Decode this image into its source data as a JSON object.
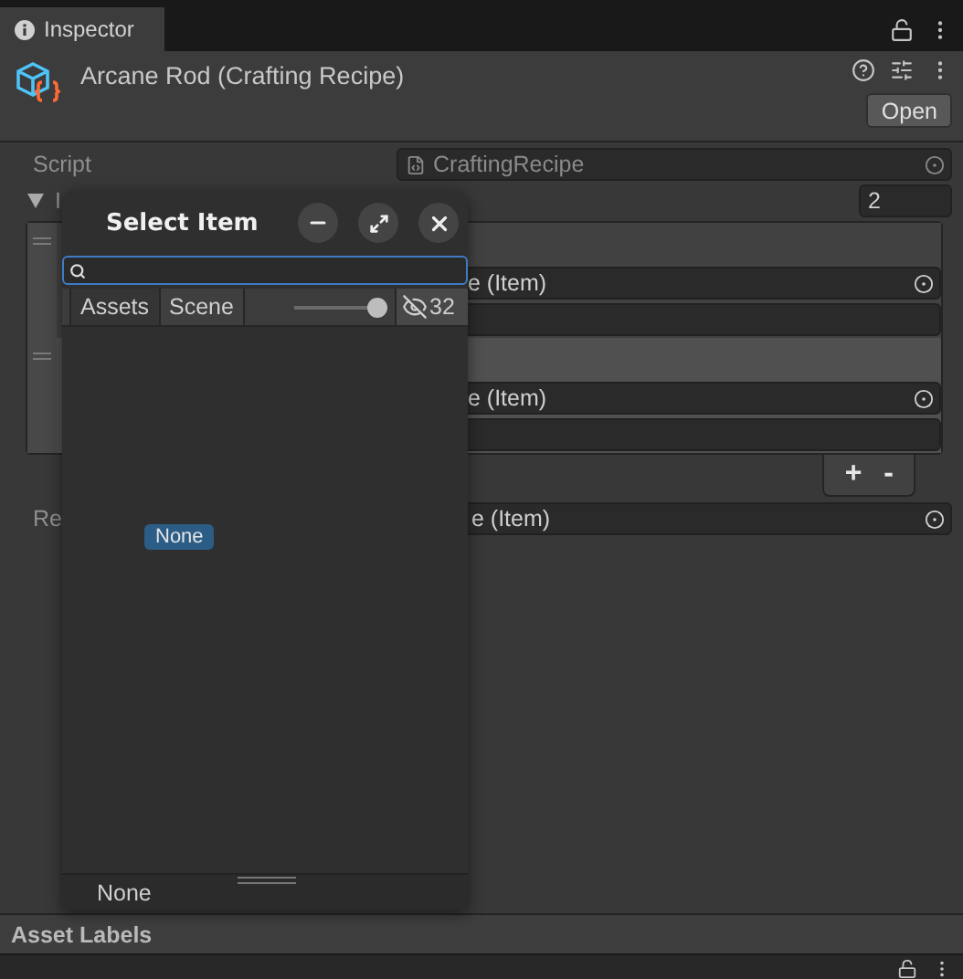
{
  "tab": {
    "label": "Inspector"
  },
  "header": {
    "title": "Arcane Rod (Crafting Recipe)",
    "open_button": "Open"
  },
  "script": {
    "label": "Script",
    "value": "CraftingRecipe"
  },
  "list": {
    "label": "I",
    "expanded": true,
    "size": "2",
    "elements": [
      {
        "item": "e (Item)",
        "selected": false
      },
      {
        "item": "e (Item)",
        "selected": true
      }
    ],
    "buttons": [
      "+",
      "-"
    ]
  },
  "result": {
    "label": "Re",
    "value": "e (Item)"
  },
  "dialog": {
    "title": "Select Item",
    "tabs": [
      {
        "label": "Assets",
        "selected": true
      },
      {
        "label": "Scene",
        "selected": false
      }
    ],
    "zoom": {
      "level": 1
    },
    "hidden_count": "32",
    "items": [
      {
        "label": "None",
        "selected": true
      }
    ],
    "footer": "None"
  },
  "asset_labels": "Asset Labels"
}
